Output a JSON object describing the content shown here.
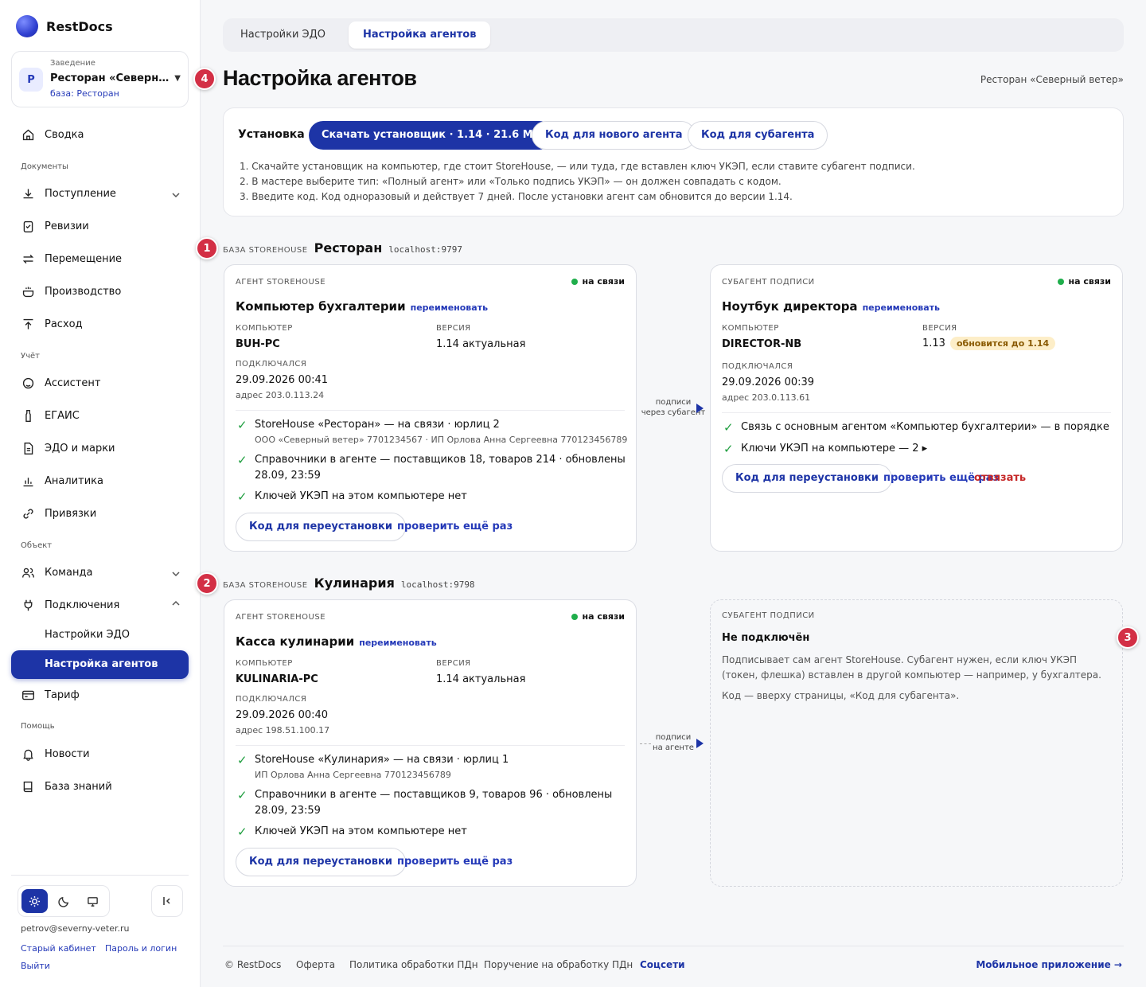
{
  "brand": {
    "name": "RestDocs"
  },
  "venue": {
    "label": "Заведение",
    "avatar": "Р",
    "name": "Ресторан «Северный ветер»",
    "base": "база: Ресторан"
  },
  "nav": {
    "summary": "Сводка",
    "sec_docs": "Документы",
    "incoming": "Поступление",
    "audits": "Ревизии",
    "transfer": "Перемещение",
    "production": "Производство",
    "expense": "Расход",
    "sec_accounting": "Учёт",
    "assistant": "Ассистент",
    "egais": "ЕГАИС",
    "edo": "ЭДО и марки",
    "analytics": "Аналитика",
    "bindings": "Привязки",
    "sec_object": "Объект",
    "team": "Команда",
    "connections": "Подключения",
    "edo_settings": "Настройки ЭДО",
    "agent_settings": "Настройка агентов",
    "tariff": "Тариф",
    "sec_help": "Помощь",
    "news": "Новости",
    "kb": "База знаний"
  },
  "sidebar_footer": {
    "email": "petrov@severny-veter.ru",
    "old_cabinet": "Старый кабинет",
    "password": "Пароль и логин",
    "logout": "Выйти"
  },
  "tabs": [
    "Настройки ЭДО",
    "Настройка агентов"
  ],
  "page": {
    "title": "Настройка агентов",
    "venue": "Ресторан «Северный ветер»"
  },
  "badges": [
    "1",
    "2",
    "3",
    "4"
  ],
  "install": {
    "title": "Установка",
    "download": "Скачать установщик · 1.14 · 21.6 МБ",
    "new_agent_code": "Код для нового агента",
    "subagent_code": "Код для субагента",
    "steps": [
      "1. Скачайте установщик на компьютер, где стоит StoreHouse, — или туда, где вставлен ключ УКЭП, если ставите субагент подписи.",
      "2. В мастере выберите тип: «Полный агент» или «Только подпись УКЭП» — он должен совпадать с кодом.",
      "3. Введите код. Код одноразовый и действует 7 дней. После установки агент сам обновится до версии 1.14."
    ]
  },
  "labels": {
    "base_storehouse": "БАЗА STOREHOUSE",
    "agent_storehouse": "АГЕНТ STOREHOUSE",
    "subagent": "СУБАГЕНТ ПОДПИСИ",
    "computer": "КОМПЬЮТЕР",
    "version": "ВЕРСИЯ",
    "connected": "ПОДКЛЮЧАЛСЯ",
    "online": "на связи",
    "rename": "переименовать",
    "reinstall": "Код для переустановки",
    "check_again": "проверить ещё раз",
    "unbind": "отвязать"
  },
  "base1": {
    "name": "Ресторан",
    "host": "localhost:9797",
    "agent": {
      "title": "Компьютер бухгалтерии",
      "computer": "BUH-PC",
      "version": "1.14 актуальная",
      "date": "29.09.2026 00:41",
      "addr": "адрес 203.0.113.24",
      "c1": "StoreHouse «Ресторан» — на связи · юрлиц 2",
      "c1s": "ООО «Северный ветер» 7701234567 · ИП Орлова Анна Сергеевна 770123456789",
      "c2": "Справочники в агенте — поставщиков 18, товаров 214 · обновлены",
      "c2b": "28.09, 23:59",
      "c3": "Ключей УКЭП на этом компьютере нет"
    },
    "connector": {
      "l1": "подписи",
      "l2": "через субагент"
    },
    "sub": {
      "title": "Ноутбук директора",
      "computer": "DIRECTOR-NB",
      "version": "1.13",
      "update": "обновится до 1.14",
      "date": "29.09.2026 00:39",
      "addr": "адрес 203.0.113.61",
      "c1": "Связь с основным агентом «Компьютер бухгалтерии» — в порядке",
      "c2": "Ключи УКЭП на компьютере — 2 ▸"
    }
  },
  "base2": {
    "name": "Кулинария",
    "host": "localhost:9798",
    "agent": {
      "title": "Касса кулинарии",
      "computer": "KULINARIA-PC",
      "version": "1.14 актуальная",
      "date": "29.09.2026 00:40",
      "addr": "адрес 198.51.100.17",
      "c1": "StoreHouse «Кулинария» — на связи · юрлиц 1",
      "c1s": "ИП Орлова Анна Сергеевна 770123456789",
      "c2": "Справочники в агенте — поставщиков 9, товаров 96 · обновлены",
      "c2b": "28.09, 23:59",
      "c3": "Ключей УКЭП на этом компьютере нет"
    },
    "connector": {
      "l1": "подписи",
      "l2": "на агенте"
    },
    "sub": {
      "title": "Не подключён",
      "p1": "Подписывает сам агент StoreHouse. Субагент нужен, если ключ УКЭП (токен, флешка) вставлен в другой компьютер — например, у бухгалтера.",
      "p2": "Код — вверху страницы, «Код для субагента»."
    }
  },
  "footer": {
    "copy": "© RestDocs",
    "offer": "Оферта",
    "policy": "Политика обработки ПДн",
    "instruction": "Поручение на обработку ПДн",
    "social": "Соцсети",
    "mobile": "Мобильное приложение →"
  }
}
